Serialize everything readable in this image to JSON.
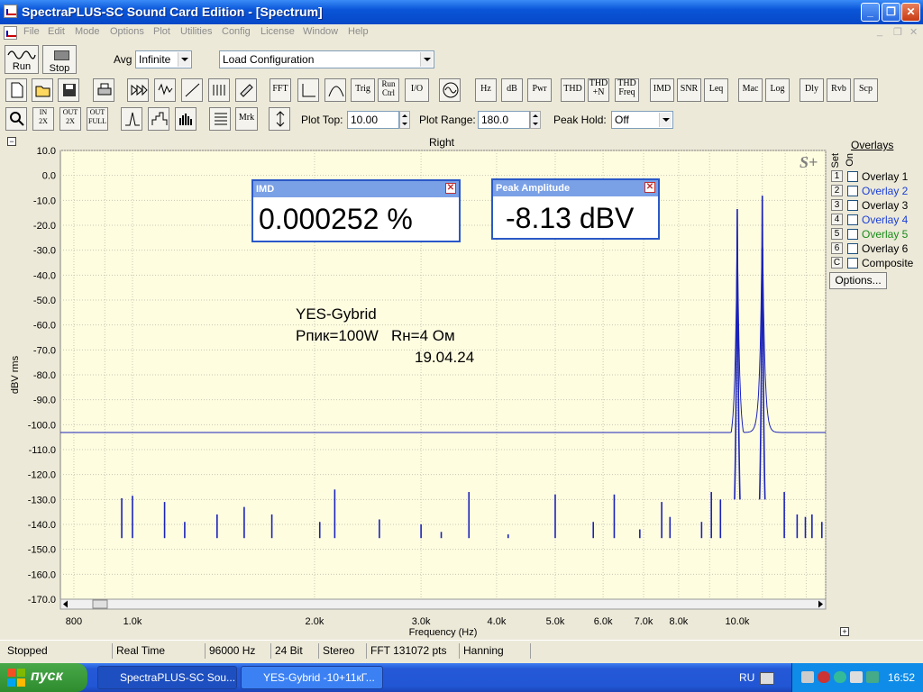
{
  "window": {
    "title": "SpectraPLUS-SC Sound Card Edition - [Spectrum]"
  },
  "menu": [
    "File",
    "Edit",
    "Mode",
    "Options",
    "Plot",
    "Utilities",
    "Config",
    "License",
    "Window",
    "Help"
  ],
  "toolbar1": {
    "run_label": "Run",
    "stop_label": "Stop",
    "avg_label": "Avg",
    "avg_value": "Infinite",
    "config_value": "Load Configuration"
  },
  "toolbar2": {
    "buttons": [
      "FFT",
      "Trig",
      "Run Ctrl",
      "I/O",
      "Hz",
      "dB",
      "Pwr",
      "THD",
      "THD +N",
      "THD Freq",
      "IMD",
      "SNR",
      "Leq",
      "Mac",
      "Log",
      "Dly",
      "Rvb",
      "Scp"
    ]
  },
  "toolbar3": {
    "mrk_label": "Mrk",
    "plot_top_label": "Plot Top:",
    "plot_top_value": "10.00",
    "plot_range_label": "Plot Range:",
    "plot_range_value": "180.0",
    "peak_hold_label": "Peak Hold:",
    "peak_hold_value": "Off"
  },
  "plot": {
    "channel_title": "Right",
    "logo": "S+"
  },
  "readouts": {
    "imd_title": "IMD",
    "imd_value": "0.000252 %",
    "peak_title": "Peak Amplitude",
    "peak_value": "-8.13 dBV"
  },
  "annotation": {
    "line1": "YES-Gybrid",
    "line2": "Рпик=100W   Rн=4 Ом",
    "line3": "19.04.24"
  },
  "overlays": {
    "title": "Overlays",
    "set_label": "Set",
    "on_label": "On",
    "items": [
      {
        "num": "1",
        "label": "Overlay 1",
        "color": "#000000"
      },
      {
        "num": "2",
        "label": "Overlay 2",
        "color": "#1a3fd8"
      },
      {
        "num": "3",
        "label": "Overlay 3",
        "color": "#000000"
      },
      {
        "num": "4",
        "label": "Overlay 4",
        "color": "#1a3fd8"
      },
      {
        "num": "5",
        "label": "Overlay 5",
        "color": "#1a8c1a"
      },
      {
        "num": "6",
        "label": "Overlay 6",
        "color": "#000000"
      },
      {
        "num": "C",
        "label": "Composite",
        "color": "#000000"
      }
    ],
    "options_label": "Options..."
  },
  "status": [
    "Stopped",
    "Real Time",
    "96000 Hz",
    "24 Bit",
    "Stereo",
    "FFT 131072 pts",
    "Hanning"
  ],
  "taskbar": {
    "start_label": "пуск",
    "tasks": [
      "SpectraPLUS-SC Sou...",
      "YES-Gybrid -10+11кГ..."
    ],
    "lang": "RU",
    "clock": "16:52"
  },
  "chart_data": {
    "type": "line",
    "xlabel": "Frequency (Hz)",
    "ylabel": "dBV rms",
    "xscale": "log",
    "xlim": [
      760,
      14000
    ],
    "ylim": [
      -170,
      10
    ],
    "yticks": [
      "10.0",
      "0.0",
      "-10.0",
      "-20.0",
      "-30.0",
      "-40.0",
      "-50.0",
      "-60.0",
      "-70.0",
      "-80.0",
      "-90.0",
      "-100.0",
      "-110.0",
      "-120.0",
      "-130.0",
      "-140.0",
      "-150.0",
      "-160.0",
      "-170.0"
    ],
    "xticks": [
      {
        "v": 800,
        "label": "800"
      },
      {
        "v": 1000,
        "label": "1.0k"
      },
      {
        "v": 2000,
        "label": "2.0k"
      },
      {
        "v": 3000,
        "label": "3.0k"
      },
      {
        "v": 4000,
        "label": "4.0k"
      },
      {
        "v": 5000,
        "label": "5.0k"
      },
      {
        "v": 6000,
        "label": "6.0k"
      },
      {
        "v": 7000,
        "label": "7.0k"
      },
      {
        "v": 8000,
        "label": "8.0k"
      },
      {
        "v": 10000,
        "label": "10.0k"
      }
    ],
    "grid": true,
    "noise_floor": -145.5,
    "tones": [
      {
        "f": 10000,
        "dbv": -13.5
      },
      {
        "f": 11000,
        "dbv": -8.13
      }
    ],
    "spurs": [
      {
        "f": 1000,
        "dbv": -128.5
      },
      {
        "f": 960,
        "dbv": -129.5
      },
      {
        "f": 1130,
        "dbv": -131
      },
      {
        "f": 1220,
        "dbv": -139
      },
      {
        "f": 1380,
        "dbv": -136
      },
      {
        "f": 1530,
        "dbv": -133
      },
      {
        "f": 1700,
        "dbv": -136
      },
      {
        "f": 2040,
        "dbv": -139
      },
      {
        "f": 2160,
        "dbv": -126
      },
      {
        "f": 2560,
        "dbv": -138
      },
      {
        "f": 3000,
        "dbv": -140
      },
      {
        "f": 3240,
        "dbv": -143
      },
      {
        "f": 3600,
        "dbv": -127
      },
      {
        "f": 4180,
        "dbv": -144
      },
      {
        "f": 5000,
        "dbv": -128
      },
      {
        "f": 5780,
        "dbv": -139
      },
      {
        "f": 6260,
        "dbv": -128
      },
      {
        "f": 6900,
        "dbv": -142
      },
      {
        "f": 7500,
        "dbv": -131
      },
      {
        "f": 7740,
        "dbv": -137
      },
      {
        "f": 8730,
        "dbv": -139
      },
      {
        "f": 9060,
        "dbv": -127
      },
      {
        "f": 9380,
        "dbv": -130
      },
      {
        "f": 11960,
        "dbv": -127
      },
      {
        "f": 12560,
        "dbv": -136
      },
      {
        "f": 12960,
        "dbv": -137
      },
      {
        "f": 13290,
        "dbv": -136
      },
      {
        "f": 13800,
        "dbv": -139
      }
    ]
  }
}
